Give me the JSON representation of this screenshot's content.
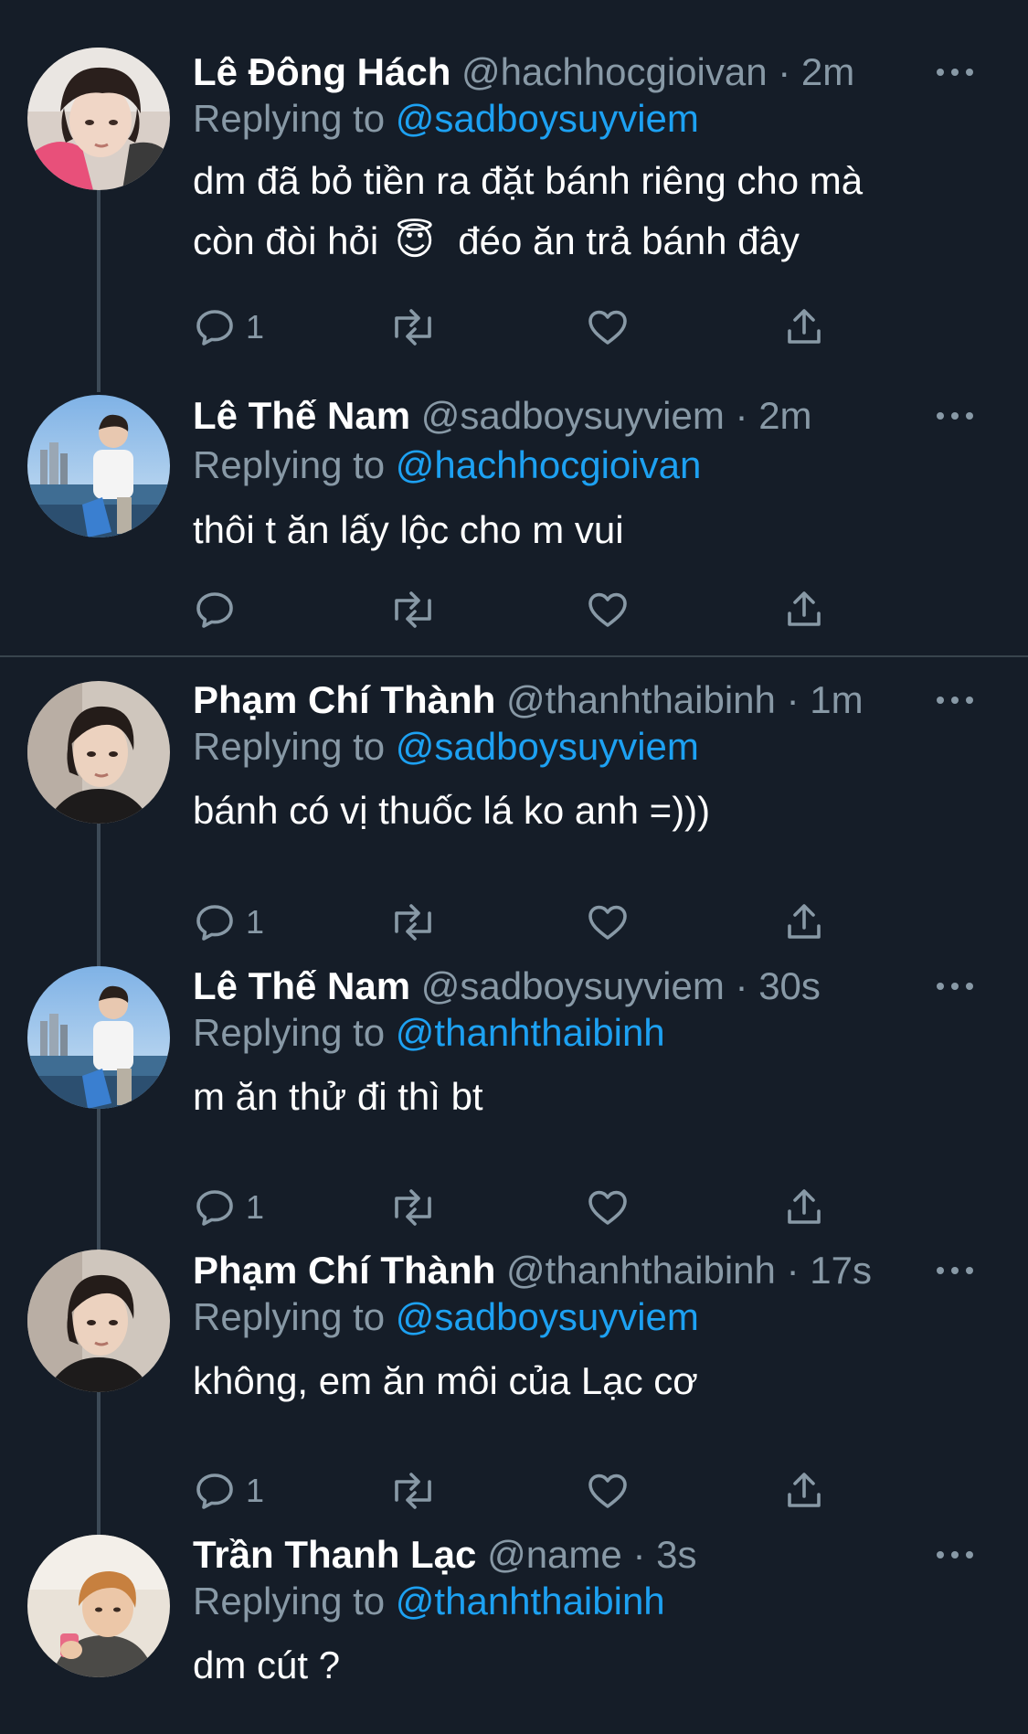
{
  "tweets": [
    {
      "name": "Lê Đông Hách",
      "handle": "@hachhocgioivan",
      "separator": "·",
      "time": "2m",
      "replying_prefix": "Replying to",
      "replying_to": "@sadboysuyviem",
      "text_line1": "dm đã bỏ tiền ra đặt bánh riêng cho mà",
      "text_line2a": "còn đòi hỏi",
      "text_emoji": "😇",
      "text_line2b": "đéo ăn trả bánh đây",
      "reply_count": "1"
    },
    {
      "name": "Lê Thế Nam",
      "handle": "@sadboysuyviem",
      "separator": "·",
      "time": "2m",
      "replying_prefix": "Replying to",
      "replying_to": "@hachhocgioivan",
      "text": "thôi t ăn lấy lộc cho m vui",
      "reply_count": ""
    },
    {
      "name": "Phạm Chí Thành",
      "handle": "@thanhthaibinh",
      "separator": "·",
      "time": "1m",
      "replying_prefix": "Replying to",
      "replying_to": "@sadboysuyviem",
      "text": "bánh có vị thuốc lá ko anh =)))",
      "reply_count": "1"
    },
    {
      "name": "Lê Thế Nam",
      "handle": "@sadboysuyviem",
      "separator": "·",
      "time": "30s",
      "replying_prefix": "Replying to",
      "replying_to": "@thanhthaibinh",
      "text": "m ăn thử đi thì bt",
      "reply_count": "1"
    },
    {
      "name": "Phạm Chí Thành",
      "handle": "@thanhthaibinh",
      "separator": "·",
      "time": "17s",
      "replying_prefix": "Replying to",
      "replying_to": "@sadboysuyviem",
      "text": "không, em ăn môi của Lạc cơ",
      "reply_count": "1"
    },
    {
      "name": "Trần Thanh Lạc",
      "handle": "@name",
      "separator": "·",
      "time": "3s",
      "replying_prefix": "Replying to",
      "replying_to": "@thanhthaibinh",
      "text": "dm cút ?"
    }
  ],
  "colors": {
    "background": "#151d28",
    "text_primary": "#ffffff",
    "text_secondary": "#8899a6",
    "link": "#1da1f2",
    "divider": "#38444d",
    "connector": "#3d4a57"
  },
  "icons": {
    "reply": "reply-icon",
    "retweet": "retweet-icon",
    "like": "heart-icon",
    "share": "share-icon",
    "more": "more-icon"
  }
}
